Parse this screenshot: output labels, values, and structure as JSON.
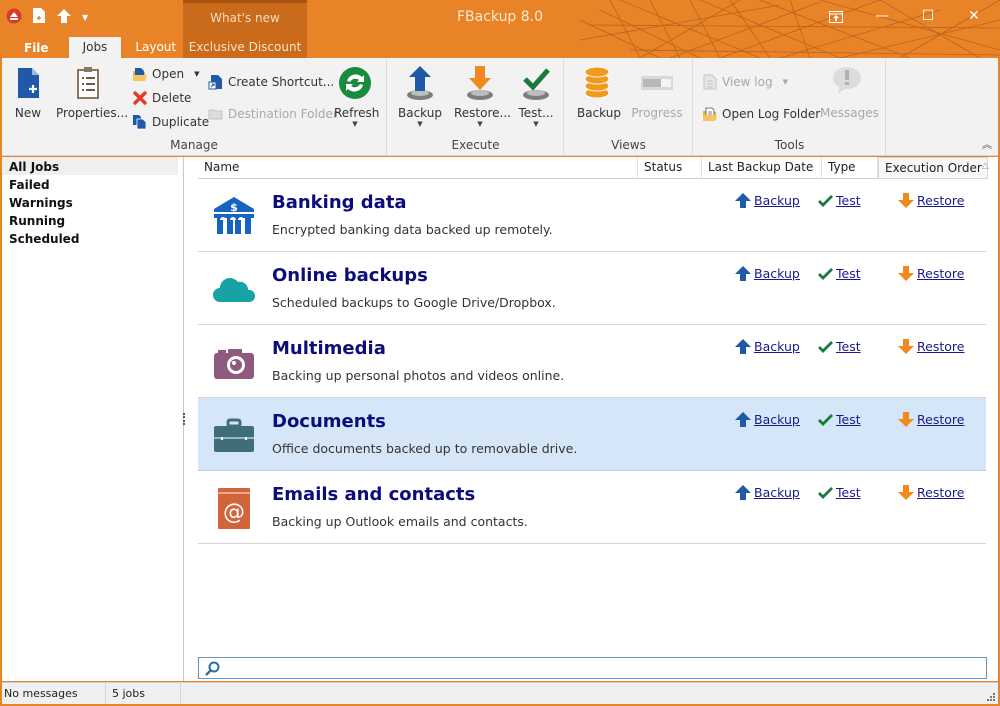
{
  "window": {
    "title": "FBackup 8.0",
    "controls": {
      "restore_panel": "panel-icon",
      "minimize": "—",
      "maximize": "☐",
      "close": "✕"
    }
  },
  "quick_access": [
    "eject-icon",
    "new-file-icon",
    "upload-arrow-icon",
    "customize-dropdown-icon"
  ],
  "contextual_group": {
    "label": "What's new"
  },
  "tabs": [
    {
      "label": "File"
    },
    {
      "label": "Jobs",
      "active": true
    },
    {
      "label": "Layout"
    },
    {
      "label": "Exclusive Discount"
    }
  ],
  "ribbon": {
    "groups": {
      "manage": {
        "label": "Manage",
        "new": "New",
        "properties": "Properties...",
        "open": "Open",
        "delete": "Delete",
        "duplicate": "Duplicate",
        "create_shortcut": "Create Shortcut...",
        "destination_folder": "Destination Folder",
        "refresh": "Refresh"
      },
      "execute": {
        "label": "Execute",
        "backup": "Backup",
        "restore": "Restore...",
        "test": "Test..."
      },
      "views": {
        "label": "Views",
        "backup": "Backup",
        "progress": "Progress"
      },
      "tools": {
        "label": "Tools",
        "view_log": "View log",
        "open_log_folder": "Open Log Folder",
        "messages": "Messages"
      }
    }
  },
  "sidebar": {
    "items": [
      {
        "label": "All Jobs",
        "active": true
      },
      {
        "label": "Failed"
      },
      {
        "label": "Warnings"
      },
      {
        "label": "Running"
      },
      {
        "label": "Scheduled"
      }
    ]
  },
  "columns": [
    {
      "label": "Name"
    },
    {
      "label": "Status"
    },
    {
      "label": "Last Backup Date"
    },
    {
      "label": "Type"
    },
    {
      "label": "Execution Order",
      "sort": "ascending"
    }
  ],
  "actions": {
    "backup": "Backup",
    "test": "Test",
    "restore": "Restore"
  },
  "jobs": [
    {
      "title": "Banking data",
      "description": "Encrypted banking data backed up remotely.",
      "icon": "bank-icon",
      "color": "#1565c0"
    },
    {
      "title": "Online backups",
      "description": "Scheduled backups to Google Drive/Dropbox.",
      "icon": "cloud-icon",
      "color": "#17a2a5"
    },
    {
      "title": "Multimedia",
      "description": "Backing up personal photos and videos online.",
      "icon": "camera-icon",
      "color": "#8e5a7e"
    },
    {
      "title": "Documents",
      "description": "Office documents backed up to removable drive.",
      "icon": "briefcase-icon",
      "color": "#3f6e78",
      "selected": true
    },
    {
      "title": "Emails and contacts",
      "description": "Backing up Outlook emails and contacts.",
      "icon": "email-book-icon",
      "color": "#d0643b"
    }
  ],
  "search": {
    "value": "",
    "placeholder": ""
  },
  "status_bar": {
    "messages": "No messages",
    "jobs_count": "5 jobs"
  },
  "colors": {
    "accent": "#e98327",
    "title_text": "#0c0d7a",
    "link": "#1a1a8c",
    "selected_row": "#d6e6f9"
  }
}
